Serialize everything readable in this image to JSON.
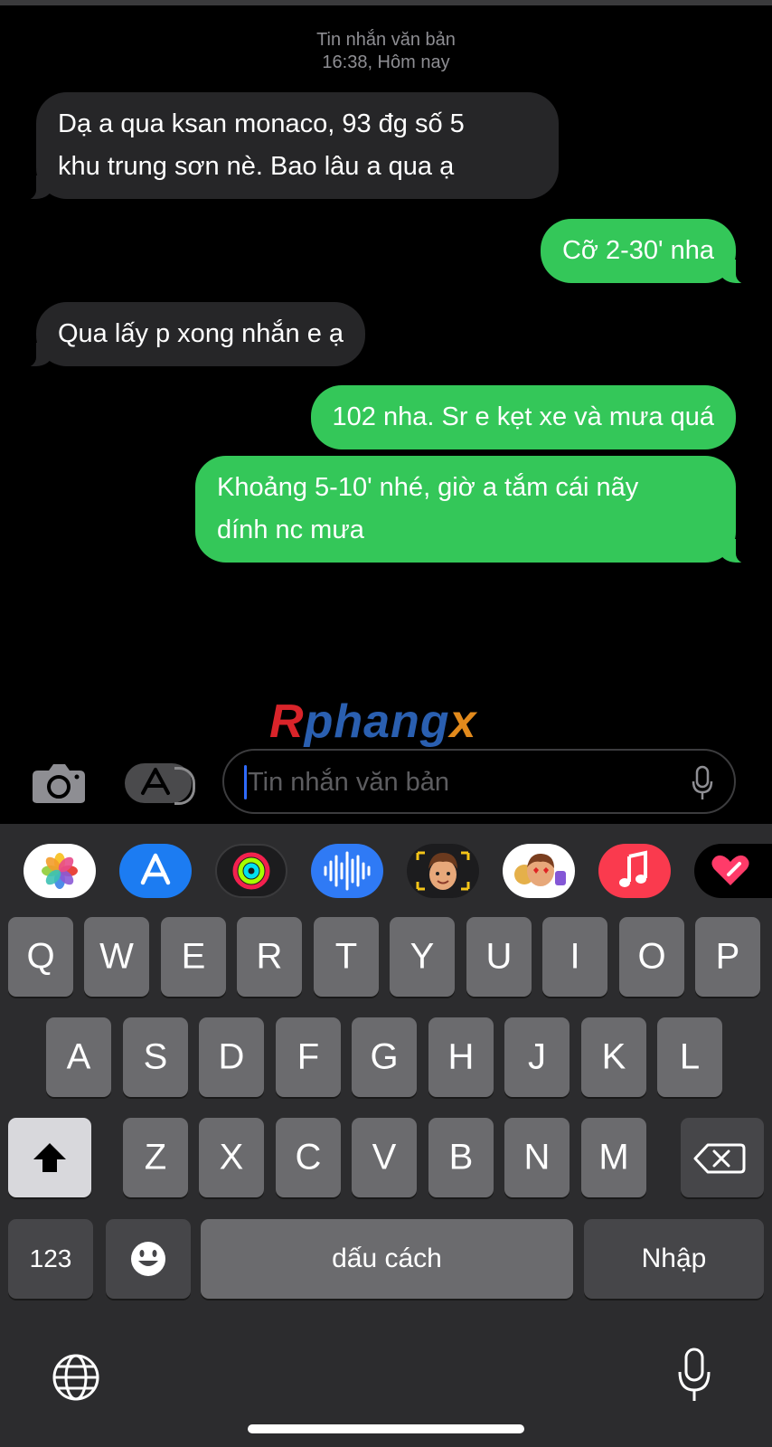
{
  "header": {
    "line1": "Tin nhắn văn bản",
    "line2": "16:38, Hôm nay"
  },
  "messages": [
    {
      "direction": "in",
      "text_line1": "Dạ a qua ksan monaco, 93 đg số 5",
      "text_line2": "khu trung sơn nè. Bao lâu a qua ạ"
    },
    {
      "direction": "out",
      "text": "Cỡ 2-30' nha"
    },
    {
      "direction": "in",
      "text": "Qua lấy p xong nhắn e ạ"
    },
    {
      "direction": "out",
      "text": "102 nha. Sr e kẹt xe và mưa quá"
    },
    {
      "direction": "out",
      "text_line1": "Khoảng 5-10' nhé, giờ a tắm cái nãy",
      "text_line2": "dính nc mưa"
    }
  ],
  "watermark": {
    "r": "R",
    "mid": "phang",
    "x": "x"
  },
  "compose": {
    "placeholder": "Tin nhắn văn bản"
  },
  "app_strip": [
    "photos-icon",
    "app-store-icon",
    "activity-icon",
    "voice-memo-icon",
    "memoji-icon",
    "memoji-stickers-icon",
    "music-icon",
    "digital-touch-icon"
  ],
  "keyboard": {
    "row1": [
      "Q",
      "W",
      "E",
      "R",
      "T",
      "Y",
      "U",
      "I",
      "O",
      "P"
    ],
    "row2": [
      "A",
      "S",
      "D",
      "F",
      "G",
      "H",
      "J",
      "K",
      "L"
    ],
    "row3": [
      "Z",
      "X",
      "C",
      "V",
      "B",
      "N",
      "M"
    ],
    "numbers_label": "123",
    "space_label": "dấu cách",
    "return_label": "Nhập"
  },
  "colors": {
    "outgoing": "#34c759",
    "incoming": "#262628",
    "background": "#000000"
  }
}
